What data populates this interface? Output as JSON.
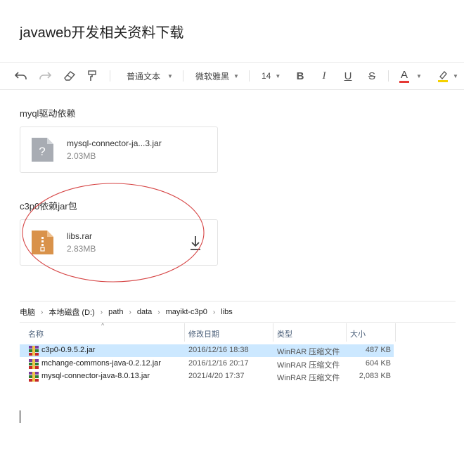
{
  "document": {
    "title": "javaweb开发相关资料下载"
  },
  "toolbar": {
    "paragraph_style": "普通文本",
    "font_family": "微软雅黑",
    "font_size": "14",
    "bold": "B",
    "italic": "I",
    "underline": "U",
    "strike": "S",
    "font_color_letter": "A",
    "font_color_accent": "#e53935",
    "highlight_accent": "#f5d100"
  },
  "sections": [
    {
      "label": "myql驱动依赖",
      "file": {
        "name": "mysql-connector-ja...3.jar",
        "size": "2.03MB",
        "icon": "unknown-file-icon"
      }
    },
    {
      "label": "c3p0依赖jar包",
      "file": {
        "name": "libs.rar",
        "size": "2.83MB",
        "icon": "archive-file-icon"
      }
    }
  ],
  "explorer": {
    "breadcrumb": [
      "电脑",
      "本地磁盘 (D:)",
      "path",
      "data",
      "mayikt-c3p0",
      "libs"
    ],
    "columns": [
      "名称",
      "修改日期",
      "类型",
      "大小"
    ],
    "rows": [
      {
        "name": "c3p0-0.9.5.2.jar",
        "date": "2016/12/16 18:38",
        "type": "WinRAR 压缩文件",
        "size": "487 KB",
        "selected": true
      },
      {
        "name": "mchange-commons-java-0.2.12.jar",
        "date": "2016/12/16 20:17",
        "type": "WinRAR 压缩文件",
        "size": "604 KB",
        "selected": false
      },
      {
        "name": "mysql-connector-java-8.0.13.jar",
        "date": "2021/4/20 17:37",
        "type": "WinRAR 压缩文件",
        "size": "2,083 KB",
        "selected": false
      }
    ]
  },
  "annotation_color": "#d64545"
}
